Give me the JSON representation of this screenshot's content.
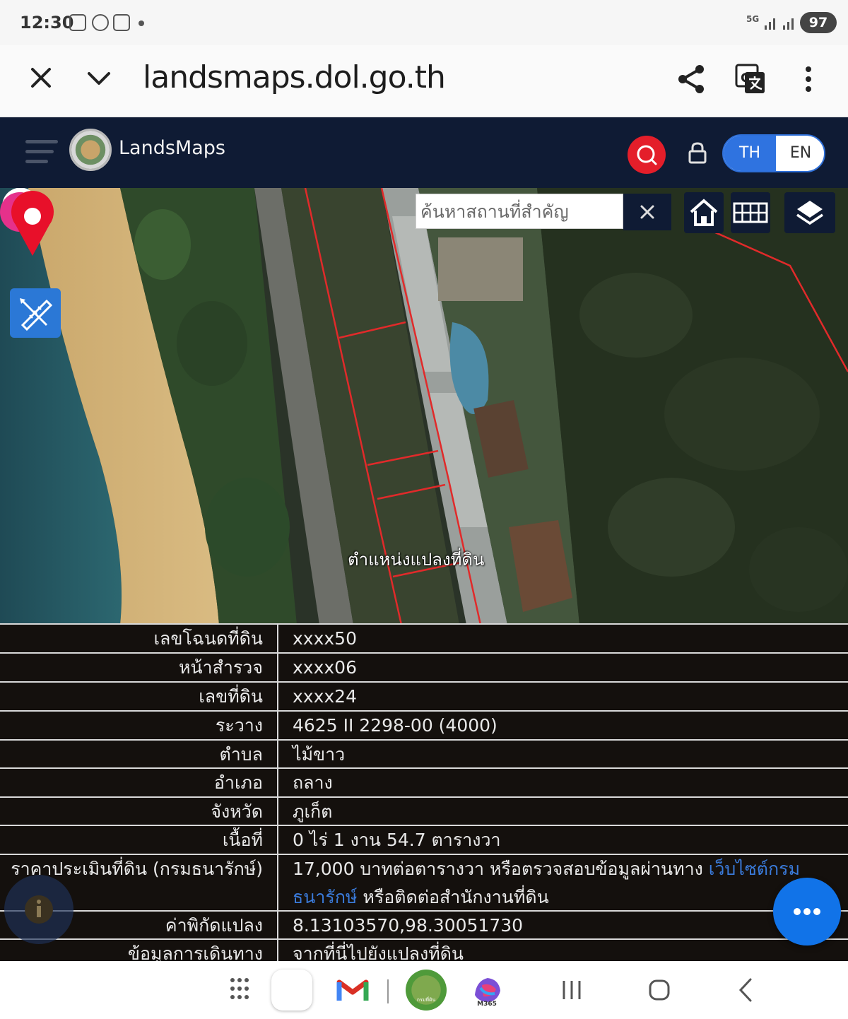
{
  "status_bar": {
    "time": "12:30",
    "network": "5G",
    "battery": "97"
  },
  "browser": {
    "url": "landsmaps.dol.go.th"
  },
  "app_header": {
    "app_name": "LandsMaps",
    "lang_th": "TH",
    "lang_en": "EN"
  },
  "map": {
    "search_placeholder": "ค้นหาสถานที่สำคัญ",
    "parcel_label": "ตำแหน่งแปลงที่ดิน"
  },
  "info_table": {
    "rows": [
      {
        "label": "เลขโฉนดที่ดิน",
        "value": "xxxx50"
      },
      {
        "label": "หน้าสำรวจ",
        "value": "xxxx06"
      },
      {
        "label": "เลขที่ดิน",
        "value": "xxxx24"
      },
      {
        "label": "ระวาง",
        "value": "4625 II 2298-00 (4000)"
      },
      {
        "label": "ตำบล",
        "value": "ไม้ขาว"
      },
      {
        "label": "อำเภอ",
        "value": "ถลาง"
      },
      {
        "label": "จังหวัด",
        "value": "ภูเก็ต"
      },
      {
        "label": "เนื้อที่",
        "value": "0 ไร่ 1 งาน 54.7 ตารางวา"
      }
    ],
    "price": {
      "label": "ราคาประเมินที่ดิน (กรมธนารักษ์)",
      "value_prefix": "17,000 บาทต่อตารางวา หรือตรวจสอบข้อมูลผ่านทาง ",
      "link_text": "เว็บไซต์กรมธนารักษ์",
      "value_suffix": " หรือติดต่อสำนักงานที่ดิน"
    },
    "coords": {
      "label": "ค่าพิกัดแปลง",
      "value": "8.13103570,98.30051730"
    },
    "directions": {
      "label": "ข้อมูลการเดินทาง",
      "value": "จากที่นี่ไปยังแปลงที่ดิน"
    }
  },
  "nav_bar": {
    "landsmaps_app_label": "กรมที่ดิน",
    "m365_label": "M365"
  }
}
